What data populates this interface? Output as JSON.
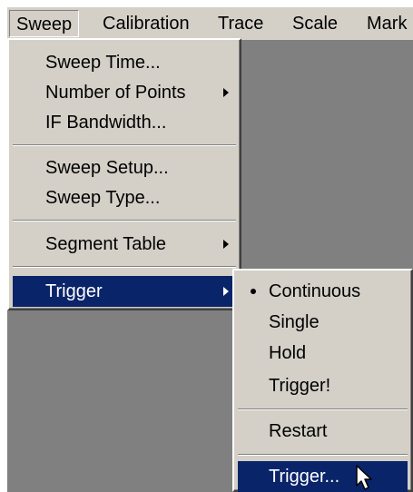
{
  "menubar": {
    "items": [
      {
        "label": "Sweep"
      },
      {
        "label": "Calibration"
      },
      {
        "label": "Trace"
      },
      {
        "label": "Scale"
      },
      {
        "label": "Mark"
      }
    ]
  },
  "sweep_menu": {
    "items": [
      {
        "label": "Sweep Time..."
      },
      {
        "label": "Number of Points",
        "submenu": true
      },
      {
        "label": "IF Bandwidth..."
      },
      {
        "label": "Sweep Setup..."
      },
      {
        "label": "Sweep Type..."
      },
      {
        "label": "Segment Table",
        "submenu": true
      },
      {
        "label": "Trigger",
        "submenu": true,
        "selected": true
      }
    ]
  },
  "trigger_menu": {
    "items": [
      {
        "label": "Continuous",
        "checked": true
      },
      {
        "label": "Single"
      },
      {
        "label": "Hold"
      },
      {
        "label": "Trigger!"
      },
      {
        "label": "Restart"
      },
      {
        "label": "Trigger...",
        "selected": true
      }
    ]
  },
  "colors": {
    "menu_face": "#d4d0c8",
    "selection": "#0a246a",
    "workspace": "#808080"
  },
  "icons": [
    "submenu-arrow-icon",
    "radio-bullet-icon",
    "mouse-pointer-icon"
  ]
}
